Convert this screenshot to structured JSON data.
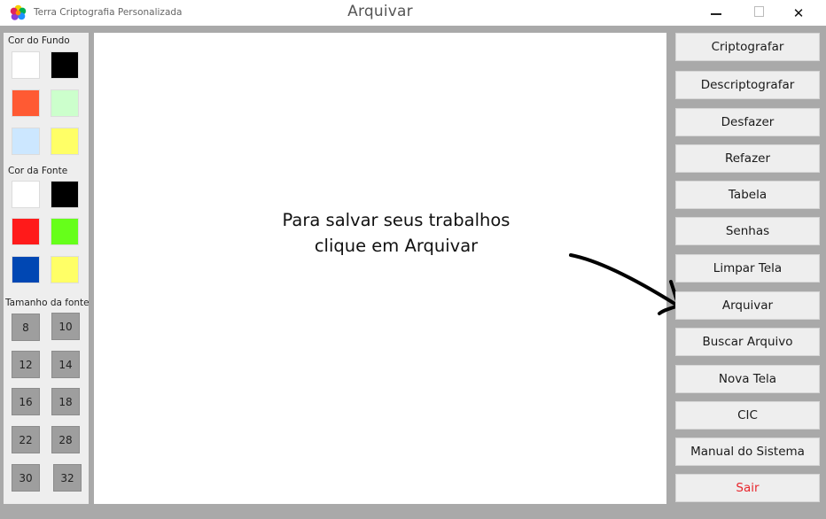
{
  "window": {
    "app_name": "Terra Criptografia Personalizada",
    "title": "Arquivar",
    "controls": {
      "close_glyph": "✕"
    }
  },
  "left_panel": {
    "background_label": "Cor do Fundo",
    "background_colors": [
      "#ffffff",
      "#000000",
      "#ff5a33",
      "#ccffcc",
      "#cce7ff",
      "#ffff66"
    ],
    "font_label": "Cor da Fonte",
    "font_colors": [
      "#ffffff",
      "#000000",
      "#ff1a1a",
      "#66ff1a",
      "#0047b3",
      "#ffff66"
    ],
    "size_label": "Tamanho da fonte",
    "sizes": [
      "8",
      "10",
      "12",
      "14",
      "16",
      "18",
      "22",
      "28",
      "30",
      "32"
    ]
  },
  "canvas": {
    "hint_line1": "Para salvar seus trabalhos",
    "hint_line2": "clique em Arquivar"
  },
  "menu": {
    "buttons": [
      "Criptografar",
      "Descriptografar",
      "Desfazer",
      "Refazer",
      "Tabela",
      "Senhas",
      "Limpar Tela",
      "Arquivar",
      "Buscar Arquivo",
      "Nova Tela",
      "CIC",
      "Manual do Sistema",
      "Sair"
    ]
  },
  "colors": {
    "window_background": "#a9a9a9",
    "panel": "#eeeeee",
    "exit_text": "#e8262d"
  }
}
